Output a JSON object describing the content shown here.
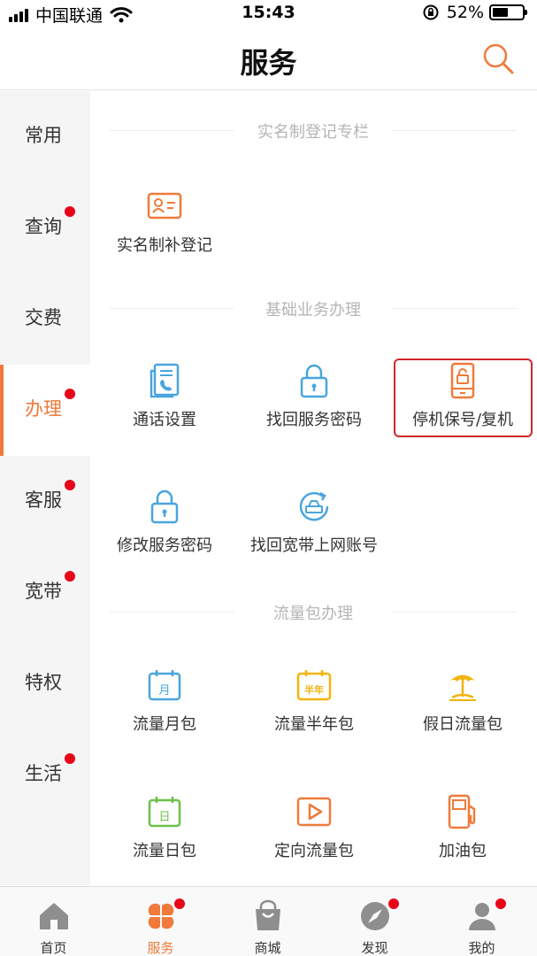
{
  "status_bar": {
    "carrier": "中国联通",
    "time": "15:43",
    "battery_text": "52%",
    "battery_level": 0.52
  },
  "header": {
    "title": "服务",
    "search_icon": "search-icon"
  },
  "colors": {
    "accent": "#ef7a3b",
    "badge": "#e8051a",
    "highlight_border": "#d0272b",
    "icon_blue": "#4aa5de",
    "icon_orange": "#ef7a3b",
    "icon_yellow": "#f2b40c",
    "icon_green": "#6cc04a"
  },
  "sidebar": {
    "items": [
      {
        "label": "常用",
        "badge": false,
        "active": false
      },
      {
        "label": "查询",
        "badge": true,
        "active": false
      },
      {
        "label": "交费",
        "badge": false,
        "active": false
      },
      {
        "label": "办理",
        "badge": true,
        "active": true
      },
      {
        "label": "客服",
        "badge": true,
        "active": false
      },
      {
        "label": "宽带",
        "badge": true,
        "active": false
      },
      {
        "label": "特权",
        "badge": false,
        "active": false
      },
      {
        "label": "生活",
        "badge": true,
        "active": false
      }
    ]
  },
  "sections": [
    {
      "title": "实名制登记专栏"
    },
    {
      "title": "基础业务办理"
    },
    {
      "title": "流量包办理"
    }
  ],
  "tiles": {
    "realname": {
      "label": "实名制补登记",
      "icon": "id-card-icon"
    },
    "call_settings": {
      "label": "通话设置",
      "icon": "call-settings-icon"
    },
    "recover_password": {
      "label": "找回服务密码",
      "icon": "lock-icon"
    },
    "suspend_resume": {
      "label": "停机保号/复机",
      "icon": "phone-lock-icon"
    },
    "change_password": {
      "label": "修改服务密码",
      "icon": "lock-icon"
    },
    "recover_broadband": {
      "label": "找回宽带上网账号",
      "icon": "broadband-recover-icon"
    },
    "monthly_pack": {
      "label": "流量月包",
      "icon": "calendar-month-icon",
      "icon_text": "月"
    },
    "halfyear_pack": {
      "label": "流量半年包",
      "icon": "calendar-halfyear-icon",
      "icon_text": "半年"
    },
    "holiday_pack": {
      "label": "假日流量包",
      "icon": "beach-umbrella-icon"
    },
    "daily_pack": {
      "label": "流量日包",
      "icon": "calendar-day-icon",
      "icon_text": "日"
    },
    "directional_pack": {
      "label": "定向流量包",
      "icon": "play-icon"
    },
    "fuel_pack": {
      "label": "加油包",
      "icon": "fuel-pump-icon"
    }
  },
  "tabbar": {
    "items": [
      {
        "label": "首页",
        "icon": "home-icon",
        "badge": false,
        "active": false
      },
      {
        "label": "服务",
        "icon": "clover-icon",
        "badge": true,
        "active": true
      },
      {
        "label": "商城",
        "icon": "shopping-bag-icon",
        "badge": false,
        "active": false
      },
      {
        "label": "发现",
        "icon": "compass-icon",
        "badge": true,
        "active": false
      },
      {
        "label": "我的",
        "icon": "user-icon",
        "badge": true,
        "active": false
      }
    ]
  }
}
